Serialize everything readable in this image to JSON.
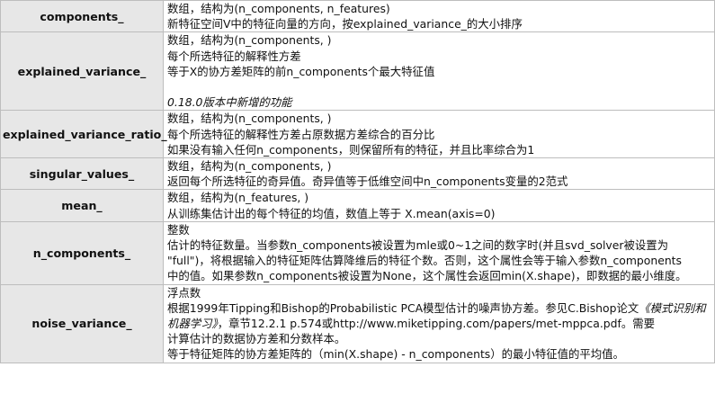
{
  "rows": [
    {
      "name": "components_",
      "lines": [
        "数组，结构为(n_components, n_features)",
        "新特征空间V中的特征向量的方向，按explained_variance_的大小排序"
      ]
    },
    {
      "name": "explained_variance_",
      "lines": [
        "数组，结构为(n_components, )",
        "每个所选特征的解释性方差",
        "等于X的协方差矩阵的前n_components个最大特征值"
      ],
      "note": "0.18.0版本中新增的功能"
    },
    {
      "name": "explained_variance_ratio_",
      "lines": [
        "数组，结构为(n_components, )",
        "每个所选特征的解释性方差占原数据方差综合的百分比",
        "如果没有输入任何n_components，则保留所有的特征，并且比率综合为1"
      ]
    },
    {
      "name": "singular_values_",
      "lines": [
        "数组，结构为(n_components, )",
        "返回每个所选特征的奇异值。奇异值等于低维空间中n_components变量的2范式"
      ]
    },
    {
      "name": "mean_",
      "lines": [
        "数组，结构为(n_features, )",
        "从训练集估计出的每个特征的均值，数值上等于 X.mean(axis=0)"
      ]
    },
    {
      "name": "n_components_",
      "lines": [
        "整数",
        "估计的特征数量。当参数n_components被设置为mle或0~1之间的数字时(并且svd_solver被设置为",
        "\"full\")，将根据输入的特征矩阵估算降维后的特征个数。否则，这个属性会等于输入参数n_components",
        "中的值。如果参数n_components被设置为None，这个属性会返回min(X.shape)，即数据的最小维度。"
      ]
    },
    {
      "name": "noise_variance_",
      "lines": [
        "浮点数"
      ],
      "ref_line": {
        "before": "根据1999年Tipping和Bishop的Probabilistic PCA模型估计的噪声协方差。参见C.Bishop论文",
        "book": "《模式识别和机器学习》",
        "after": "，章节12.2.1 p.574或http://www.miketipping.com/papers/met-mppca.pdf。需要"
      },
      "tail_lines": [
        "计算估计的数据协方差和分数样本。",
        "等于特征矩阵的协方差矩阵的（min(X.shape) - n_components）的最小特征值的平均值。"
      ]
    }
  ]
}
